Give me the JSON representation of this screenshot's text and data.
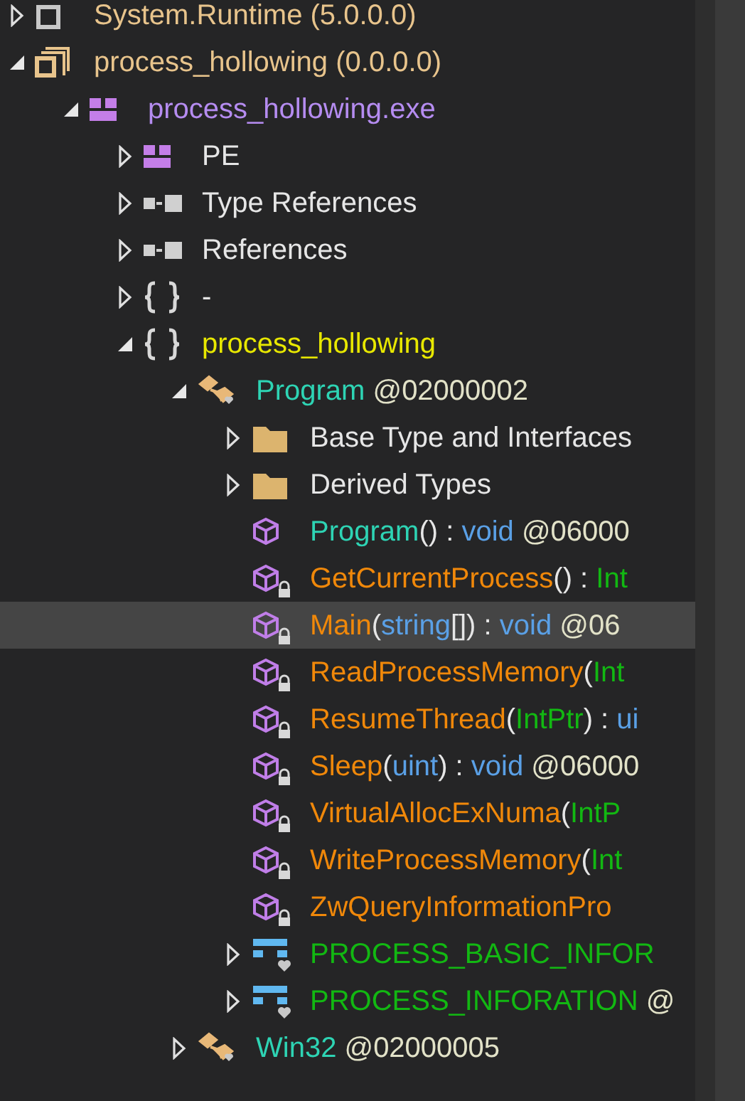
{
  "tree": [
    {
      "kind": "reference_assembly",
      "expanded": false,
      "selected": false,
      "label": [
        {
          "text": "System.Runtime (5.0.0.0)",
          "kind": "assembly"
        }
      ]
    },
    {
      "kind": "assembly",
      "expanded": true,
      "selected": false,
      "label": [
        {
          "text": "process_hollowing ",
          "kind": "assembly"
        },
        {
          "text": "(0.0.0.0)",
          "kind": "assembly"
        }
      ],
      "children": [
        {
          "kind": "module",
          "expanded": true,
          "selected": false,
          "label": [
            {
              "text": "process_hollowing.exe",
              "kind": "module"
            }
          ],
          "children": [
            {
              "kind": "module",
              "expanded": false,
              "selected": false,
              "label": [
                {
                  "text": "PE",
                  "kind": "plain"
                }
              ]
            },
            {
              "kind": "references",
              "expanded": false,
              "selected": false,
              "label": [
                {
                  "text": "Type References",
                  "kind": "plain"
                }
              ]
            },
            {
              "kind": "references",
              "expanded": false,
              "selected": false,
              "label": [
                {
                  "text": "References",
                  "kind": "plain"
                }
              ]
            },
            {
              "kind": "namespace",
              "expanded": false,
              "selected": false,
              "label": [
                {
                  "text": "-",
                  "kind": "plain"
                }
              ]
            },
            {
              "kind": "namespace",
              "expanded": true,
              "selected": false,
              "label": [
                {
                  "text": "process_hollowing",
                  "kind": "namespace"
                }
              ],
              "children": [
                {
                  "kind": "class",
                  "expanded": true,
                  "selected": false,
                  "label": [
                    {
                      "text": "Program",
                      "kind": "class"
                    },
                    {
                      "text": " @02000002",
                      "kind": "token"
                    }
                  ],
                  "children": [
                    {
                      "kind": "folder",
                      "expanded": false,
                      "selected": false,
                      "label": [
                        {
                          "text": "Base Type and Interfaces",
                          "kind": "plain"
                        }
                      ]
                    },
                    {
                      "kind": "folder",
                      "expanded": false,
                      "selected": false,
                      "label": [
                        {
                          "text": "Derived Types",
                          "kind": "plain"
                        }
                      ]
                    },
                    {
                      "kind": "method",
                      "private": false,
                      "selected": false,
                      "label": [
                        {
                          "text": "Program",
                          "kind": "class"
                        },
                        {
                          "text": "() : ",
                          "kind": "plain"
                        },
                        {
                          "text": "void",
                          "kind": "keyword"
                        },
                        {
                          "text": " @06000",
                          "kind": "token"
                        }
                      ]
                    },
                    {
                      "kind": "method",
                      "private": true,
                      "selected": false,
                      "label": [
                        {
                          "text": "GetCurrentProcess",
                          "kind": "method"
                        },
                        {
                          "text": "() : ",
                          "kind": "plain"
                        },
                        {
                          "text": "Int",
                          "kind": "struct"
                        }
                      ]
                    },
                    {
                      "kind": "method",
                      "private": true,
                      "selected": true,
                      "label": [
                        {
                          "text": "Main",
                          "kind": "method"
                        },
                        {
                          "text": "(",
                          "kind": "plain"
                        },
                        {
                          "text": "string",
                          "kind": "keyword"
                        },
                        {
                          "text": "[]) : ",
                          "kind": "plain"
                        },
                        {
                          "text": "void",
                          "kind": "keyword"
                        },
                        {
                          "text": " @06",
                          "kind": "token"
                        }
                      ]
                    },
                    {
                      "kind": "method",
                      "private": true,
                      "selected": false,
                      "label": [
                        {
                          "text": "ReadProcessMemory",
                          "kind": "method"
                        },
                        {
                          "text": "(",
                          "kind": "plain"
                        },
                        {
                          "text": "Int",
                          "kind": "struct"
                        }
                      ]
                    },
                    {
                      "kind": "method",
                      "private": true,
                      "selected": false,
                      "label": [
                        {
                          "text": "ResumeThread",
                          "kind": "method"
                        },
                        {
                          "text": "(",
                          "kind": "plain"
                        },
                        {
                          "text": "IntPtr",
                          "kind": "struct"
                        },
                        {
                          "text": ") : ",
                          "kind": "plain"
                        },
                        {
                          "text": "ui",
                          "kind": "keyword"
                        }
                      ]
                    },
                    {
                      "kind": "method",
                      "private": true,
                      "selected": false,
                      "label": [
                        {
                          "text": "Sleep",
                          "kind": "method"
                        },
                        {
                          "text": "(",
                          "kind": "plain"
                        },
                        {
                          "text": "uint",
                          "kind": "keyword"
                        },
                        {
                          "text": ") : ",
                          "kind": "plain"
                        },
                        {
                          "text": "void",
                          "kind": "keyword"
                        },
                        {
                          "text": " @06000",
                          "kind": "token"
                        }
                      ]
                    },
                    {
                      "kind": "method",
                      "private": true,
                      "selected": false,
                      "label": [
                        {
                          "text": "VirtualAllocExNuma",
                          "kind": "method"
                        },
                        {
                          "text": "(",
                          "kind": "plain"
                        },
                        {
                          "text": "IntP",
                          "kind": "struct"
                        }
                      ]
                    },
                    {
                      "kind": "method",
                      "private": true,
                      "selected": false,
                      "label": [
                        {
                          "text": "WriteProcessMemory",
                          "kind": "method"
                        },
                        {
                          "text": "(",
                          "kind": "plain"
                        },
                        {
                          "text": "Int",
                          "kind": "struct"
                        }
                      ]
                    },
                    {
                      "kind": "method",
                      "private": true,
                      "selected": false,
                      "label": [
                        {
                          "text": "ZwQueryInformationPro",
                          "kind": "method"
                        }
                      ]
                    },
                    {
                      "kind": "struct",
                      "expanded": false,
                      "selected": false,
                      "label": [
                        {
                          "text": "PROCESS_BASIC_INFOR",
                          "kind": "struct"
                        }
                      ]
                    },
                    {
                      "kind": "struct",
                      "expanded": false,
                      "selected": false,
                      "label": [
                        {
                          "text": "PROCESS_INFORATION",
                          "kind": "struct"
                        },
                        {
                          "text": " @",
                          "kind": "token"
                        }
                      ]
                    }
                  ]
                },
                {
                  "kind": "class",
                  "expanded": false,
                  "selected": false,
                  "label": [
                    {
                      "text": "Win32",
                      "kind": "class"
                    },
                    {
                      "text": " @02000005",
                      "kind": "token"
                    }
                  ]
                }
              ]
            }
          ]
        }
      ]
    }
  ]
}
